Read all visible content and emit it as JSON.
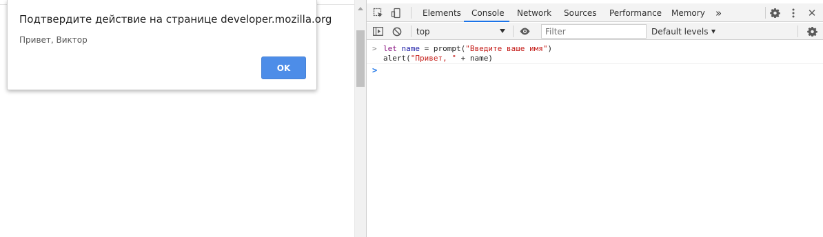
{
  "dialog": {
    "title": "Подтвердите действие на странице developer.mozilla.org",
    "message": "Привет, Виктор",
    "ok_label": "OK"
  },
  "devtools": {
    "tabs": [
      {
        "label": "Elements",
        "active": false
      },
      {
        "label": "Console",
        "active": true
      },
      {
        "label": "Network",
        "active": false
      },
      {
        "label": "Sources",
        "active": false
      },
      {
        "label": "Performance",
        "active": false
      },
      {
        "label": "Memory",
        "active": false
      }
    ],
    "more_tabs_glyph": "»",
    "close_glyph": "✕",
    "context": "top",
    "filter_placeholder": "Filter",
    "levels_label": "Default levels",
    "icons": [
      "inspect-icon",
      "device-toolbar-icon",
      "settings-icon",
      "more-vert-icon",
      "close-icon",
      "sidebar-toggle-icon",
      "clear-console-icon",
      "eye-icon",
      "console-settings-icon"
    ],
    "accent_color": "#1a73e8"
  },
  "console": {
    "entry": {
      "line1": {
        "kw": "let",
        "var": "name",
        "mid": " = prompt(",
        "str": "\"Введите ваше имя\"",
        "end": ")"
      },
      "line2": {
        "start": "alert(",
        "str": "\"Привет, \"",
        "end": " + name)"
      }
    }
  }
}
